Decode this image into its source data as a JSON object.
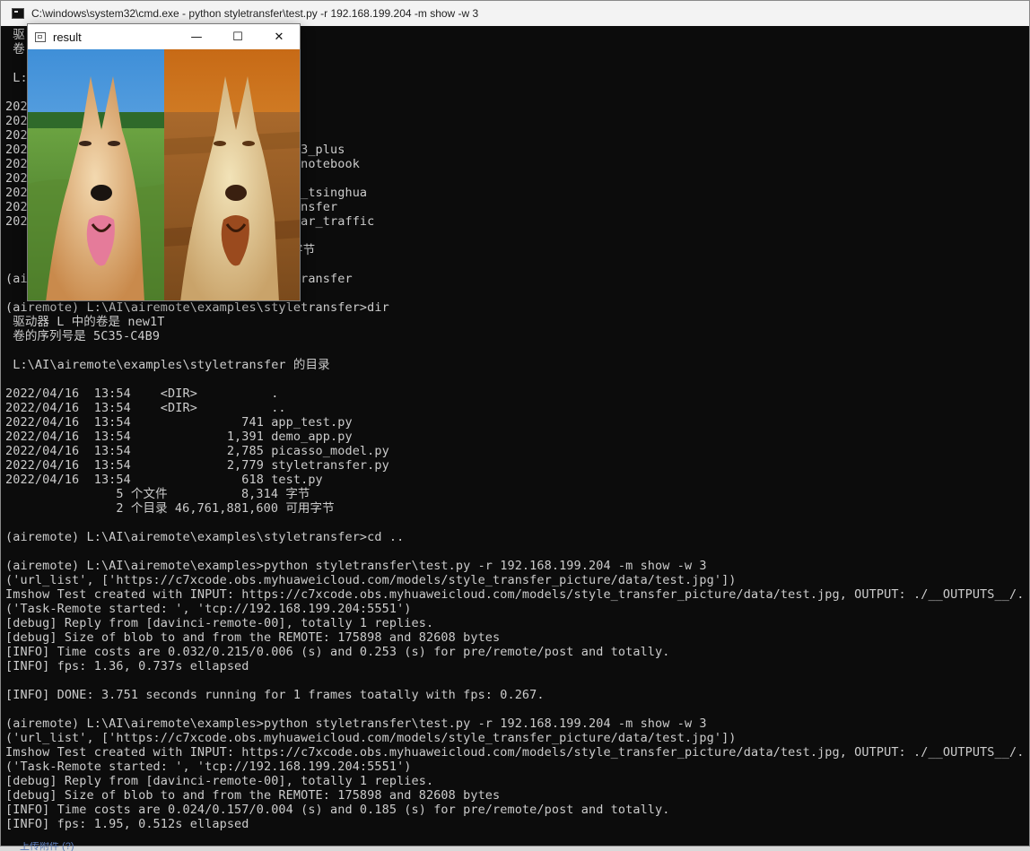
{
  "console": {
    "title": "C:\\windows\\system32\\cmd.exe - python  styletransfer\\test.py -r 192.168.199.204 -m show -w 3",
    "lines": [
      " 驱",
      " 卷",
      "",
      " L:",
      "",
      "2022",
      "2022",
      "2022                                 on",
      "2022                                 abv3_plus",
      "2022                                 er-notebook",
      "2022",
      "2022                                 ait_tsinghua",
      "2022                                 transfer",
      "2022                                 4_car_traffic",
      "                                     节",
      "                                     用字节",
      "",
      "(ai                                  letransfer",
      "",
      "(airemote) L:\\AI\\airemote\\examples\\styletransfer>dir",
      " 驱动器 L 中的卷是 new1T",
      " 卷的序列号是 5C35-C4B9",
      "",
      " L:\\AI\\airemote\\examples\\styletransfer 的目录",
      "",
      "2022/04/16  13:54    <DIR>          .",
      "2022/04/16  13:54    <DIR>          ..",
      "2022/04/16  13:54               741 app_test.py",
      "2022/04/16  13:54             1,391 demo_app.py",
      "2022/04/16  13:54             2,785 picasso_model.py",
      "2022/04/16  13:54             2,779 styletransfer.py",
      "2022/04/16  13:54               618 test.py",
      "               5 个文件          8,314 字节",
      "               2 个目录 46,761,881,600 可用字节",
      "",
      "(airemote) L:\\AI\\airemote\\examples\\styletransfer>cd ..",
      "",
      "(airemote) L:\\AI\\airemote\\examples>python styletransfer\\test.py -r 192.168.199.204 -m show -w 3",
      "('url_list', ['https://c7xcode.obs.myhuaweicloud.com/models/style_transfer_picture/data/test.jpg'])",
      "Imshow Test created with INPUT: https://c7xcode.obs.myhuaweicloud.com/models/style_transfer_picture/data/test.jpg, OUTPUT: ./__OUTPUTS__/.",
      "('Task-Remote started: ', 'tcp://192.168.199.204:5551')",
      "[debug] Reply from [davinci-remote-00], totally 1 replies.",
      "[debug] Size of blob to and from the REMOTE: 175898 and 82608 bytes",
      "[INFO] Time costs are 0.032/0.215/0.006 (s) and 0.253 (s) for pre/remote/post and totally.",
      "[INFO] fps: 1.36, 0.737s ellapsed",
      "",
      "[INFO] DONE: 3.751 seconds running for 1 frames toatally with fps: 0.267.",
      "",
      "(airemote) L:\\AI\\airemote\\examples>python styletransfer\\test.py -r 192.168.199.204 -m show -w 3",
      "('url_list', ['https://c7xcode.obs.myhuaweicloud.com/models/style_transfer_picture/data/test.jpg'])",
      "Imshow Test created with INPUT: https://c7xcode.obs.myhuaweicloud.com/models/style_transfer_picture/data/test.jpg, OUTPUT: ./__OUTPUTS__/.",
      "('Task-Remote started: ', 'tcp://192.168.199.204:5551')",
      "[debug] Reply from [davinci-remote-00], totally 1 replies.",
      "[debug] Size of blob to and from the REMOTE: 175898 and 82608 bytes",
      "[INFO] Time costs are 0.024/0.157/0.004 (s) and 0.185 (s) for pre/remote/post and totally.",
      "[INFO] fps: 1.95, 0.512s ellapsed"
    ]
  },
  "result_window": {
    "title": "result",
    "minimize": "—",
    "maximize": "☐",
    "close": "✕"
  },
  "bottom_fragment": "上传附件 (?)",
  "colors": {
    "console_bg": "#0c0c0c",
    "console_text": "#cccccc",
    "titlebar_bg": "#f3f3f3"
  },
  "icons": {
    "console": "cmd-icon",
    "result": "window-icon"
  }
}
